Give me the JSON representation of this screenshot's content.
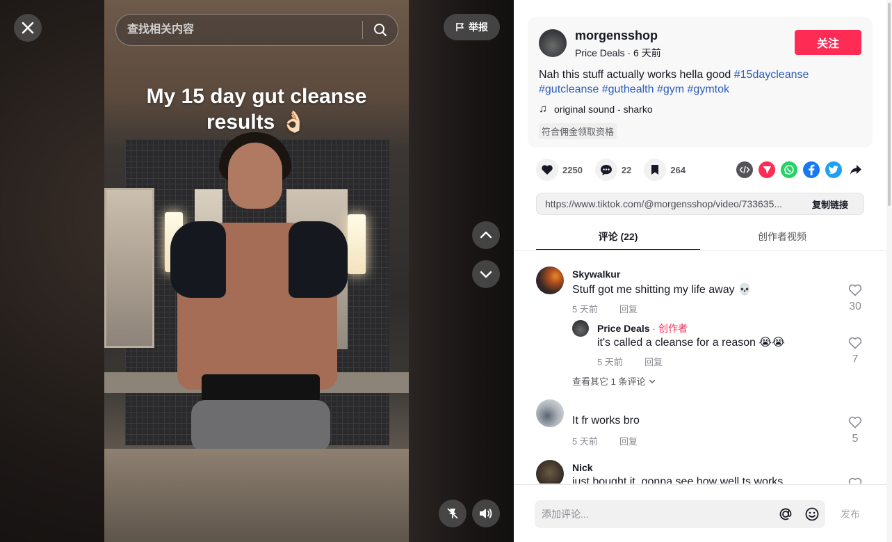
{
  "search": {
    "placeholder": "查找相关内容"
  },
  "report": {
    "label": "举报"
  },
  "video": {
    "caption_line1": "My 15 day gut cleanse",
    "caption_line2": "results 👌🏻"
  },
  "author": {
    "username": "morgensshop",
    "nickname": "Price Deals",
    "posted": "6 天前",
    "follow_label": "关注"
  },
  "description": {
    "text": "Nah this stuff actually works hella good",
    "tags": [
      "#15daycleanse",
      "#gutcleanse",
      "#guthealth",
      "#gym",
      "#gymtok"
    ]
  },
  "music": {
    "label": "original sound - sharko"
  },
  "commission": "符合佣金领取资格",
  "actions": {
    "likes": "2250",
    "comments": "22",
    "saves": "264"
  },
  "share_icons": [
    "embed-icon",
    "send-icon",
    "whatsapp-icon",
    "facebook-icon",
    "twitter-icon",
    "share-arrow-icon"
  ],
  "link": {
    "url": "https://www.tiktok.com/@morgensshop/video/733635...",
    "copy_label": "复制链接"
  },
  "tabs": [
    {
      "label": "评论 (22)",
      "active": true
    },
    {
      "label": "创作者视频",
      "active": false
    }
  ],
  "comments": [
    {
      "user": "Skywalkur",
      "text": "Stuff got me shitting my life away 💀",
      "time": "5 天前",
      "reply": "回复",
      "likes": "30"
    },
    {
      "user": "Price Deals",
      "badge": "创作者",
      "text": "it's called a cleanse for a reason 😭😭",
      "time": "5 天前",
      "reply": "回复",
      "likes": "7"
    },
    {
      "more": "查看其它 1 条评论"
    },
    {
      "user": "",
      "text": "It fr works bro",
      "time": "5 天前",
      "reply": "回复",
      "likes": "5"
    },
    {
      "user": "Nick",
      "text": "just bought it, gonna see how well ts works"
    }
  ],
  "comment_input": {
    "placeholder": "添加评论...",
    "post_label": "发布"
  },
  "colors": {
    "accent": "#fe2c55",
    "tag": "#2b5db9",
    "whatsapp": "#25d366",
    "facebook": "#1877f2",
    "twitter": "#1da1f2"
  }
}
